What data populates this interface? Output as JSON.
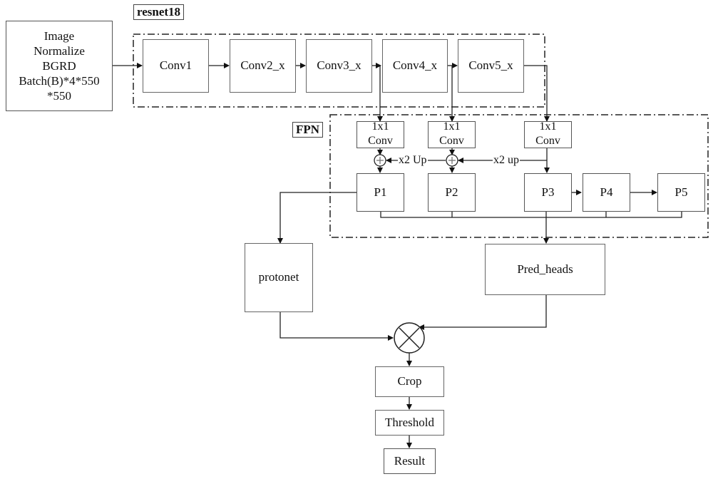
{
  "diagram": {
    "input_box": {
      "lines": [
        "Image",
        "Normalize",
        "BGRD",
        "Batch(B)*4*550",
        "*550"
      ]
    },
    "backbone": {
      "label": "resnet18",
      "blocks": [
        "Conv1",
        "Conv2_x",
        "Conv3_x",
        "Conv4_x",
        "Conv5_x"
      ]
    },
    "fpn": {
      "label": "FPN",
      "lateral_convs": [
        {
          "line1": "1x1",
          "line2": "Conv"
        },
        {
          "line1": "1x1",
          "line2": "Conv"
        },
        {
          "line1": "1x1",
          "line2": "Conv"
        }
      ],
      "upsample_labels": [
        "x2 Up",
        "x2 up"
      ],
      "levels": [
        "P1",
        "P2",
        "P3",
        "P4",
        "P5"
      ]
    },
    "protonet": "protonet",
    "pred_heads": "Pred_heads",
    "combine_op": "multiply",
    "post": [
      "Crop",
      "Threshold",
      "Result"
    ]
  }
}
